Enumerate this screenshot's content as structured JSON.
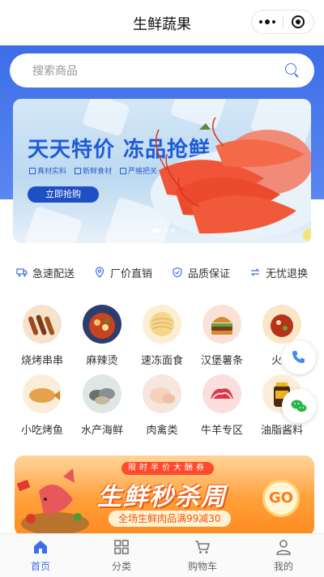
{
  "header": {
    "title": "生鲜蔬果"
  },
  "search": {
    "placeholder": "搜索商品"
  },
  "banner": {
    "headline": "天天特价 冻品抢鲜",
    "tags": [
      "真材实料",
      "新鲜食材",
      "严格把关"
    ],
    "button": "立即抢购"
  },
  "services": [
    {
      "label": "急速配送",
      "icon": "truck-icon"
    },
    {
      "label": "厂价直销",
      "icon": "location-icon"
    },
    {
      "label": "品质保证",
      "icon": "shield-icon"
    },
    {
      "label": "无忧退换",
      "icon": "exchange-icon"
    }
  ],
  "categories": [
    {
      "label": "烧烤串串"
    },
    {
      "label": "麻辣烫"
    },
    {
      "label": "速冻面食"
    },
    {
      "label": "汉堡薯条"
    },
    {
      "label": "火锅"
    },
    {
      "label": "小吃烤鱼"
    },
    {
      "label": "水产海鲜"
    },
    {
      "label": "肉禽类"
    },
    {
      "label": "牛羊专区"
    },
    {
      "label": "油脂酱料"
    }
  ],
  "promo": {
    "badge": "限时半价大酬券",
    "title": "生鲜秒杀周",
    "subtitle": "全场生鲜肉品满99减30",
    "go": "GO"
  },
  "tabbar": [
    {
      "label": "首页",
      "active": true
    },
    {
      "label": "分类",
      "active": false
    },
    {
      "label": "购物车",
      "active": false
    },
    {
      "label": "我的",
      "active": false
    }
  ],
  "colors": {
    "primary": "#3d6ee8",
    "promo": "#ff8a1f"
  }
}
